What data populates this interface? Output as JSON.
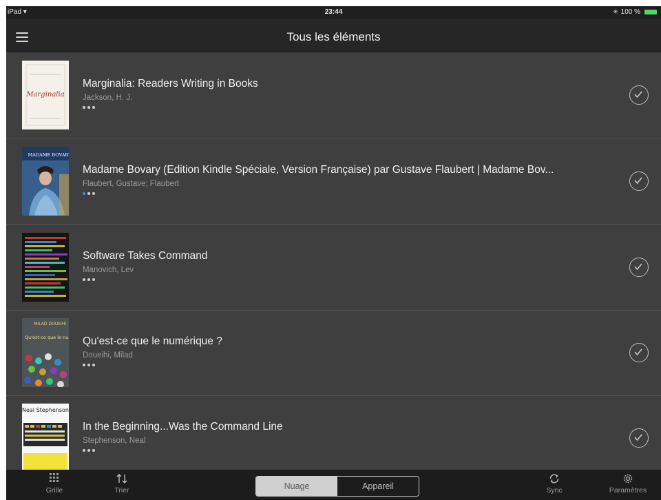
{
  "status": {
    "device": "iPad",
    "time": "23:44",
    "battery": "100 %"
  },
  "nav": {
    "title": "Tous les éléments"
  },
  "books": [
    {
      "title": "Marginalia: Readers Writing in Books",
      "author": "Jackson, H. J.",
      "cover_text": "Marginalia"
    },
    {
      "title": "Madame Bovary (Edition Kindle Spéciale, Version Française) par Gustave Flaubert | Madame Bov...",
      "author": "Flaubert, Gustave; Flaubert",
      "cover_text": "MADAME BOVARY"
    },
    {
      "title": "Software Takes Command",
      "author": "Manovich, Lev"
    },
    {
      "title": "Qu'est-ce que le numérique ?",
      "author": "Doueihi, Milad",
      "cover_text": "MILAD DOUEIHI",
      "cover_text2": "Qu'est-ce que le numérique?"
    },
    {
      "title": "In the Beginning...Was the Command Line",
      "author": "Stephenson, Neal",
      "cover_text": "Neal Stephenson"
    }
  ],
  "toolbar": {
    "grid": "Grille",
    "sort": "Trier",
    "cloud": "Nuage",
    "device": "Appareil",
    "sync": "Sync",
    "settings": "Paramètres"
  },
  "colors": {
    "background": "#3f3f3f",
    "bar": "#262626",
    "progress_blue": "#2f8cff",
    "battery": "#4cd964"
  },
  "icons": [
    "menu-icon",
    "check-circle-icon",
    "grid-icon",
    "sort-icon",
    "sync-icon",
    "gear-icon",
    "wifi-icon",
    "bluetooth-icon",
    "battery-icon"
  ]
}
